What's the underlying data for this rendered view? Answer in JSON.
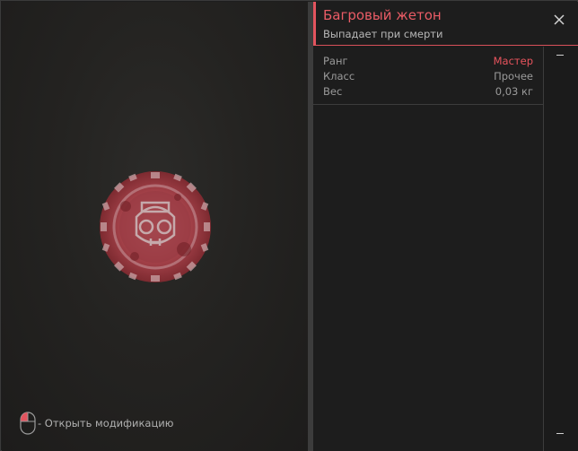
{
  "item": {
    "title": "Багровый жетон",
    "subtitle": "Выпадает при смерти"
  },
  "stats": [
    {
      "label": "Ранг",
      "value": "Мастер"
    },
    {
      "label": "Класс",
      "value": "Прочее"
    },
    {
      "label": "Вес",
      "value": "0,03 кг"
    }
  ],
  "hint": {
    "text": "- Открыть модификацию"
  },
  "icons": {
    "close": "close-icon",
    "mouse": "mouse-left-click-icon",
    "scroll_up": "scroll-up-icon",
    "scroll_down": "scroll-down-icon"
  },
  "colors": {
    "accent": "#e2545e",
    "rank": "#e8545d",
    "background": "#1e1e1e"
  }
}
